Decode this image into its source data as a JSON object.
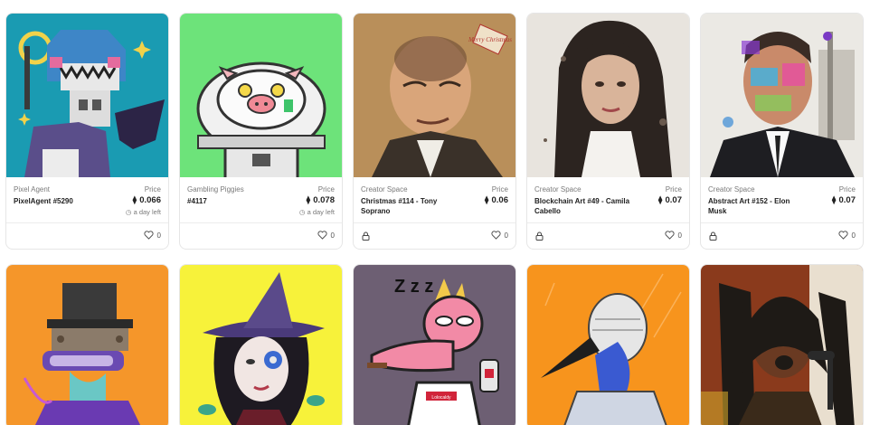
{
  "nfts": [
    {
      "collection": "Pixel Agent",
      "name": "PixelAgent #5290",
      "price_label": "Price",
      "price": "0.066",
      "time_left": "a day left",
      "likes": "0",
      "art_bg": "#1a9bb2"
    },
    {
      "collection": "Gambling Piggies",
      "name": "#4117",
      "price_label": "Price",
      "price": "0.078",
      "time_left": "a day left",
      "likes": "0",
      "art_bg": "#6de37a"
    },
    {
      "collection": "Creator Space",
      "name": "Christmas #114 - Tony Soprano",
      "price_label": "Price",
      "price": "0.06",
      "likes": "0",
      "art_bg": "#c9a06a",
      "art_text": "Merry Christmas"
    },
    {
      "collection": "Creator Space",
      "name": "Blockchain Art #49 - Camila Cabello",
      "price_label": "Price",
      "price": "0.07",
      "likes": "0",
      "art_bg": "#e8e4de"
    },
    {
      "collection": "Creator Space",
      "name": "Abstract Art #152 - Elon Musk",
      "price_label": "Price",
      "price": "0.07",
      "likes": "0",
      "art_bg": "#ebe9e4"
    }
  ],
  "nfts_row2": [
    {
      "art_bg": "#f5962a"
    },
    {
      "art_bg": "#f7f23a"
    },
    {
      "art_bg": "#6d5f73",
      "art_text": "Z z z",
      "shirt_text": "Lolocaldy"
    },
    {
      "art_bg": "#f7941d"
    },
    {
      "art_bg": "#8a3a1c"
    }
  ],
  "icons": {
    "eth": "ethereum-icon",
    "clock": "clock-icon",
    "heart": "heart-icon",
    "lock": "lock-icon"
  }
}
